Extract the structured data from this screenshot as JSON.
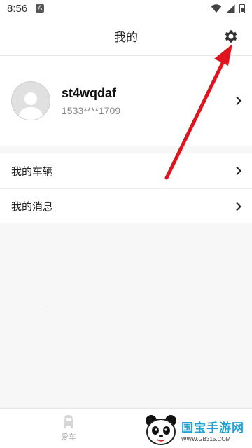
{
  "status": {
    "time": "8:56",
    "notification_badge": "A"
  },
  "header": {
    "title": "我的",
    "settings_icon": "gear-icon"
  },
  "profile": {
    "username": "st4wqdaf",
    "phone": "1533****1709"
  },
  "menu": {
    "items": [
      {
        "label": "我的车辆"
      },
      {
        "label": "我的消息"
      }
    ]
  },
  "bottom_nav": {
    "items": [
      {
        "label": "爱车",
        "icon": "car-icon"
      }
    ]
  },
  "watermark": {
    "title": "国宝手游网",
    "url": "WWW.GB315.COM"
  },
  "colors": {
    "arrow": "#e0141e",
    "accent": "#1fa3d8"
  }
}
